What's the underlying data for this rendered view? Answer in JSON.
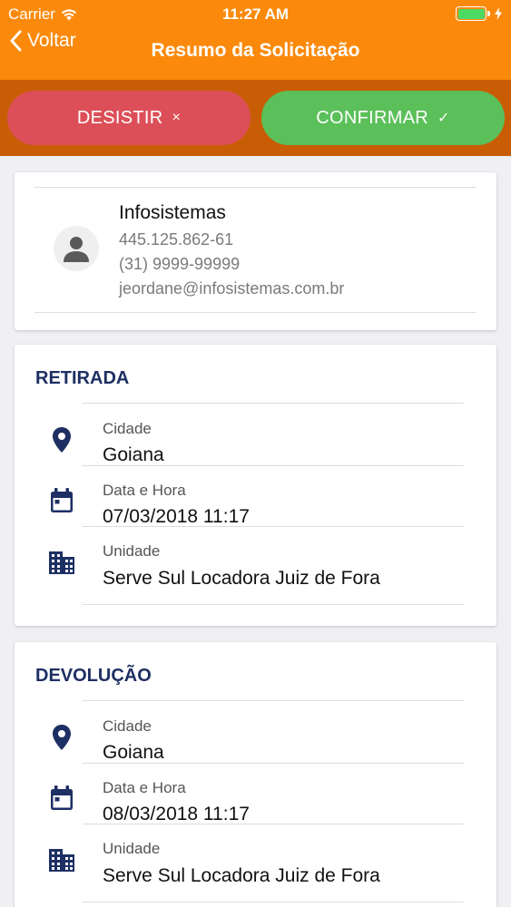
{
  "status_bar": {
    "carrier": "Carrier",
    "time": "11:27 AM"
  },
  "nav": {
    "back_label": "Voltar",
    "title": "Resumo da Solicitação"
  },
  "actions": {
    "cancel_label": "DESISTIR",
    "cancel_glyph": "×",
    "confirm_label": "CONFIRMAR",
    "confirm_glyph": "✓"
  },
  "user": {
    "name": "Infosistemas",
    "document": "445.125.862-61",
    "phone": "(31) 9999-99999",
    "email": "jeordane@infosistemas.com.br"
  },
  "retirada": {
    "title": "RETIRADA",
    "fields": [
      {
        "label": "Cidade",
        "value": "Goiana",
        "icon": "location-pin-icon"
      },
      {
        "label": "Data e Hora",
        "value": "07/03/2018 11:17",
        "icon": "calendar-icon"
      },
      {
        "label": "Unidade",
        "value": "Serve Sul Locadora Juiz de Fora",
        "icon": "building-icon"
      }
    ]
  },
  "devolucao": {
    "title": "DEVOLUÇÃO",
    "fields": [
      {
        "label": "Cidade",
        "value": "Goiana",
        "icon": "location-pin-icon"
      },
      {
        "label": "Data e Hora",
        "value": "08/03/2018 11:17",
        "icon": "calendar-icon"
      },
      {
        "label": "Unidade",
        "value": "Serve Sul Locadora Juiz de Fora",
        "icon": "building-icon"
      }
    ]
  },
  "colors": {
    "header": "#fb8a0c",
    "action_bar": "#c95d05",
    "cancel": "#dc4f58",
    "confirm": "#5bbf5a",
    "section_title": "#1e2f63",
    "icon": "#1e2f63"
  }
}
